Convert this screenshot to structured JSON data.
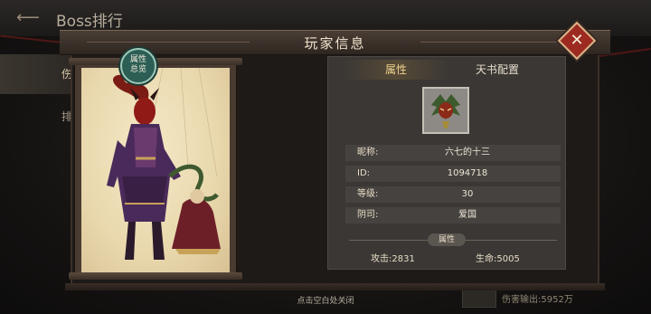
{
  "background": {
    "title": "Boss排行",
    "tabs": [
      "伤害排行",
      "排行奖励"
    ],
    "damage_text": "伤害输出:5952万"
  },
  "modal": {
    "title": "玩家信息",
    "close_icon": "close-x-icon",
    "badge": [
      "属性",
      "总览"
    ],
    "tabs": [
      {
        "label": "属性",
        "active": true
      },
      {
        "label": "天书配置",
        "active": false
      }
    ],
    "fields": [
      {
        "label": "昵称:",
        "value": "六七的十三"
      },
      {
        "label": "ID:",
        "value": "1094718"
      },
      {
        "label": "等级:",
        "value": "30"
      },
      {
        "label": "阴司:",
        "value": "爱国"
      }
    ],
    "attributes_title": "属性",
    "stats": [
      {
        "label": "攻击:",
        "value": "2831"
      },
      {
        "label": "生命:",
        "value": "5005"
      }
    ]
  },
  "footer_hint": "点击空白处关闭",
  "colors": {
    "accent_gold": "#f0d38f",
    "close_red": "#9c2a20",
    "badge_teal": "#2c5e55",
    "candle_flame": "#45d17a"
  }
}
